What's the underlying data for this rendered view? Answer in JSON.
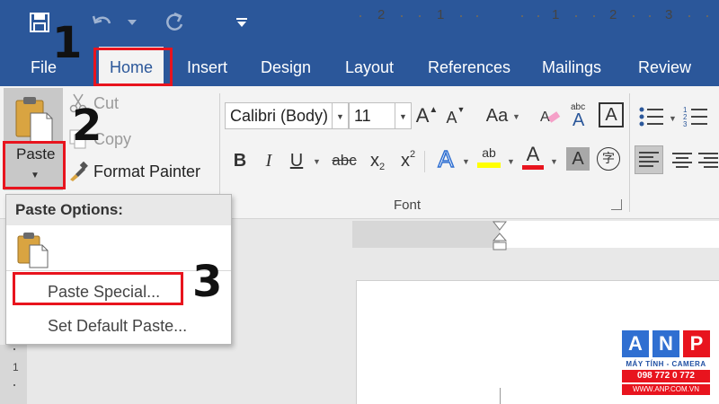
{
  "window": {
    "qat": {
      "save": "save-icon",
      "undo": "undo-icon",
      "redo": "redo-icon",
      "customize": "customize-qat-icon"
    }
  },
  "tabs": [
    {
      "label": "File",
      "active": false
    },
    {
      "label": "Home",
      "active": true
    },
    {
      "label": "Insert",
      "active": false
    },
    {
      "label": "Design",
      "active": false
    },
    {
      "label": "Layout",
      "active": false
    },
    {
      "label": "References",
      "active": false
    },
    {
      "label": "Mailings",
      "active": false
    },
    {
      "label": "Review",
      "active": false
    }
  ],
  "clipboard": {
    "paste_label": "Paste",
    "cut_label": "Cut",
    "copy_label": "Copy",
    "format_painter_label": "Format Painter"
  },
  "font": {
    "font_name": "Calibri (Body)",
    "font_size": "11",
    "group_label": "Font",
    "grow_label": "A",
    "shrink_label": "A",
    "case_label": "Aa",
    "bold": "B",
    "italic": "I",
    "underline": "U",
    "strikethrough": "abc",
    "subscript": "x",
    "subscript_mark": "2",
    "superscript": "x",
    "superscript_mark": "2",
    "text_effects": "A",
    "highlight": "ab",
    "font_color": "A",
    "shading": "A",
    "enclose_char": "字",
    "phonetic": "abc",
    "char_border": "A",
    "highlight_color": "#ffff00",
    "font_color_value": "#e8141e"
  },
  "ruler": {
    "numbers": [
      "2",
      "1",
      "1",
      "2",
      "3"
    ]
  },
  "vruler": {
    "number": "1"
  },
  "paste_menu": {
    "header": "Paste Options:",
    "paste_special": "Paste Special...",
    "set_default": "Set Default Paste..."
  },
  "steps": {
    "one": "1",
    "two": "2",
    "three": "3",
    "highlight_color": "#e8141e"
  },
  "logo": {
    "letters": [
      "A",
      "N",
      "P"
    ],
    "subtitle": "MÁY TÍNH - CAMERA",
    "phone": "098 772 0 772",
    "website": "WWW.ANP.COM.VN"
  },
  "colors": {
    "word_blue": "#2b579a",
    "ribbon_bg": "#f3f3f3",
    "logo_blue": "#2f6fd1",
    "logo_red": "#e8141e"
  }
}
